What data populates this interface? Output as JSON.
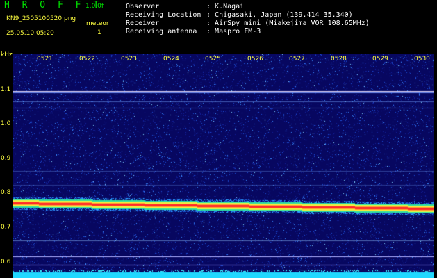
{
  "header": {
    "app_name": "H R O F F T",
    "version": "1.0.0f",
    "filename": "KN9_2505100520.png",
    "mode_label": "meteor",
    "datetime": "25.05.10 05:20",
    "mode_value": "1",
    "info": [
      {
        "label": "Observer",
        "value": "K.Nagai"
      },
      {
        "label": "Receiving Location",
        "value": "Chigasaki, Japan (139.414 35.340)"
      },
      {
        "label": "Receiver",
        "value": "AirSpy mini (Miakejima VOR 108.65MHz)"
      },
      {
        "label": "Receiving antenna",
        "value": "Maspro FM-3"
      }
    ]
  },
  "spectrogram": {
    "y_unit": "kHz",
    "y_ticks": [
      "1.1",
      "1.0",
      "0.9",
      "0.8",
      "0.7",
      "0.6"
    ],
    "x_ticks": [
      "0521",
      "0522",
      "0523",
      "0524",
      "0525",
      "0526",
      "0527",
      "0528",
      "0529",
      "0530"
    ],
    "colors": {
      "background": "#0a0a6e",
      "text_header": "#00e000",
      "text_axis": "#ffff40",
      "carrier": "#ff3030",
      "noise": "#2e7fff"
    }
  }
}
